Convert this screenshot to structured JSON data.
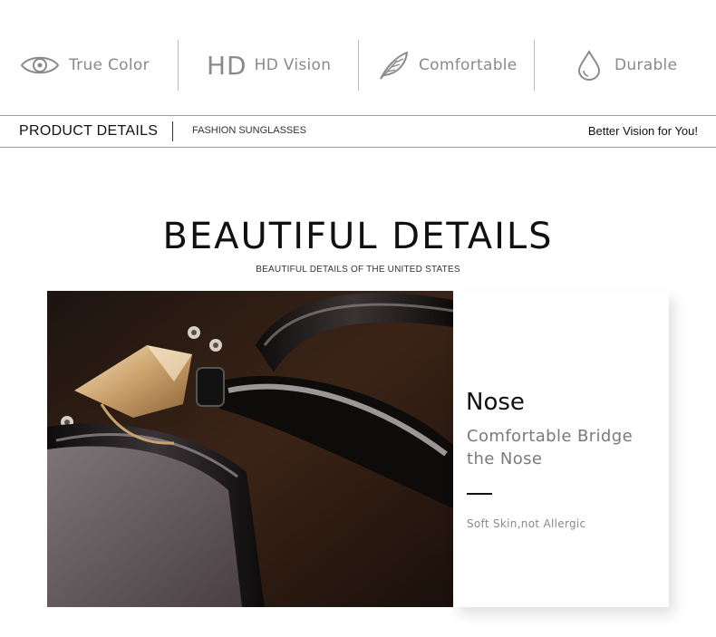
{
  "features": [
    {
      "icon": "eye-icon",
      "label": "True Color"
    },
    {
      "icon": "hd-icon",
      "mark": "HD",
      "label": "HD Vision"
    },
    {
      "icon": "feather-icon",
      "label": "Comfortable"
    },
    {
      "icon": "water-drop-icon",
      "label": "Durable"
    }
  ],
  "details_bar": {
    "title": "PRODUCT DETAILS",
    "subtitle": "FASHION SUNGLASSES",
    "tagline": "Better Vision for You!"
  },
  "heading": {
    "title": "BEAUTIFUL DETAILS",
    "subtitle": "BEAUTIFUL DETAILS OF THE UNITED STATES"
  },
  "card": {
    "title": "Nose",
    "description": "Comfortable Bridge the Nose",
    "note": "Soft Skin,not Allergic"
  },
  "colors": {
    "icon_gray": "#8a8a8a",
    "divider": "#9e9e9e",
    "text_dark": "#111111"
  }
}
